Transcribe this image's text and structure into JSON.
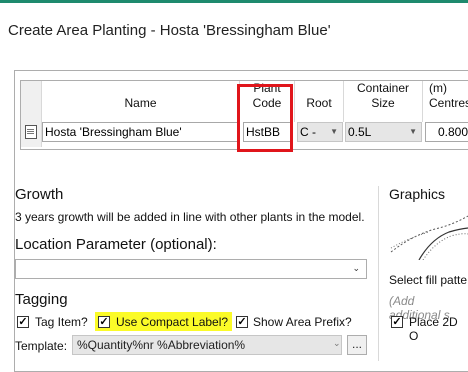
{
  "window": {
    "title": "Create Area Planting - Hosta 'Bressingham Blue'",
    "accent_color": "#1e8a6e"
  },
  "grid": {
    "columns": {
      "name": "Name",
      "plant_code": [
        "Plant",
        "Code"
      ],
      "root": "Root",
      "container": [
        "Container",
        "Size"
      ],
      "centres": [
        "(m)",
        "Centres"
      ]
    },
    "row": {
      "name": "Hosta 'Bressingham Blue'",
      "plant_code": "HstBB",
      "root": "C -",
      "container": "0.5L",
      "centres": "0.800"
    },
    "highlight_color": "#e0151b"
  },
  "growth": {
    "heading": "Growth",
    "text": "3 years growth will be added in line with other plants in the model."
  },
  "location": {
    "heading": "Location Parameter (optional):",
    "value": ""
  },
  "tagging": {
    "heading": "Tagging",
    "tag_item": {
      "label": "Tag Item?",
      "checked": true
    },
    "compact_label": {
      "label": "Use Compact Label?",
      "checked": true,
      "highlight": "#fbfb28"
    },
    "area_prefix": {
      "label": "Show Area Prefix?",
      "checked": true
    },
    "template_label": "Template:",
    "template_value": "%Quantity%nr %Abbreviation%",
    "ellipsis": "..."
  },
  "graphics": {
    "heading": "Graphics",
    "fill_label": "Select fill patte",
    "add_hint": "(Add additional s",
    "place_2d": {
      "label": "Place 2D O",
      "checked": true
    }
  },
  "icons": {
    "row_icon": "document-icon",
    "dropdown": "chevron-down-icon",
    "check": "check-icon"
  }
}
